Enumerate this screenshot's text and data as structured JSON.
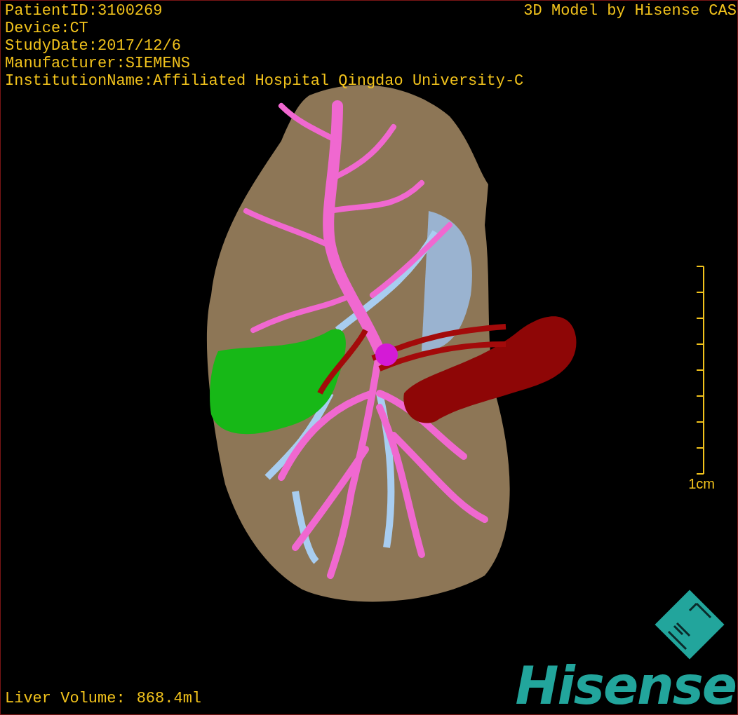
{
  "info_lines": [
    "PatientID:3100269",
    "Device:CT",
    "StudyDate:2017/12/6",
    "Manufacturer:SIEMENS",
    "InstitutionName:Affiliated Hospital Qingdao University-C"
  ],
  "title": "3D Model by Hisense CAS",
  "scale_bar": {
    "label": "1cm"
  },
  "liver_volume": {
    "label": "Liver Volume:",
    "value": "868.4ml"
  },
  "logo": {
    "text": "Hisense"
  }
}
